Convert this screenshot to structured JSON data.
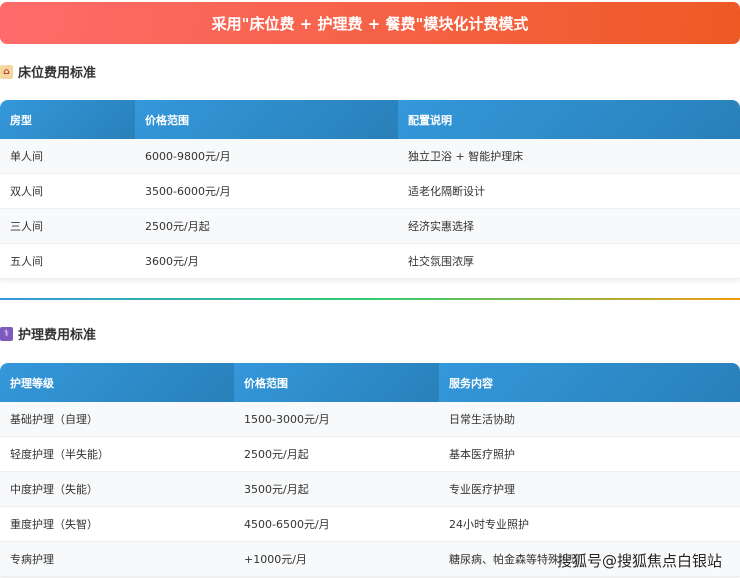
{
  "banner": "采用\"床位费 + 护理费 + 餐费\"模块化计费模式",
  "bed": {
    "title": "床位费用标准",
    "headers": [
      "房型",
      "价格范围",
      "配置说明"
    ],
    "rows": [
      [
        "单人间",
        "6000-9800元/月",
        "独立卫浴 + 智能护理床"
      ],
      [
        "双人间",
        "3500-6000元/月",
        "适老化隔断设计"
      ],
      [
        "三人间",
        "2500元/月起",
        "经济实惠选择"
      ],
      [
        "五人间",
        "3600元/月",
        "社交氛围浓厚"
      ]
    ]
  },
  "care": {
    "title": "护理费用标准",
    "headers": [
      "护理等级",
      "价格范围",
      "服务内容"
    ],
    "rows": [
      [
        "基础护理（自理）",
        "1500-3000元/月",
        "日常生活协助"
      ],
      [
        "轻度护理（半失能）",
        "2500元/月起",
        "基本医疗照护"
      ],
      [
        "中度护理（失能）",
        "3500元/月起",
        "专业医疗护理"
      ],
      [
        "重度护理（失智）",
        "4500-6500元/月",
        "24小时专业照护"
      ],
      [
        "专病护理",
        "+1000元/月",
        "糖尿病、帕金森等特殊护理"
      ]
    ]
  },
  "watermark": "搜狐号@搜狐焦点白银站"
}
